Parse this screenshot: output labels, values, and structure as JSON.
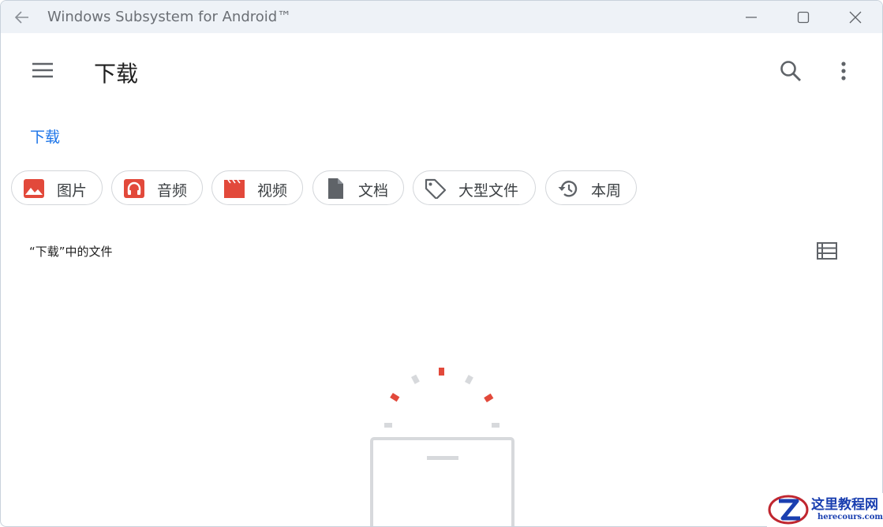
{
  "window": {
    "title": "Windows Subsystem for Android™"
  },
  "appbar": {
    "heading": "下载"
  },
  "breadcrumb": {
    "label": "下载"
  },
  "chips": [
    {
      "label": "图片",
      "icon": "image-icon",
      "color": "#e2493b"
    },
    {
      "label": "音频",
      "icon": "headphones-icon",
      "color": "#e2493b"
    },
    {
      "label": "视频",
      "icon": "movie-icon",
      "color": "#e2493b"
    },
    {
      "label": "文档",
      "icon": "document-icon",
      "color": "#5f6368"
    },
    {
      "label": "大型文件",
      "icon": "tag-icon",
      "color": "#5f6368"
    },
    {
      "label": "本周",
      "icon": "history-icon",
      "color": "#5f6368"
    }
  ],
  "files": {
    "section_label": "“下载”中的文件"
  },
  "watermark": {
    "cn": "这里教程网",
    "en": "herecours.com"
  },
  "colors": {
    "accent": "#1a73e8",
    "red": "#e2493b"
  }
}
